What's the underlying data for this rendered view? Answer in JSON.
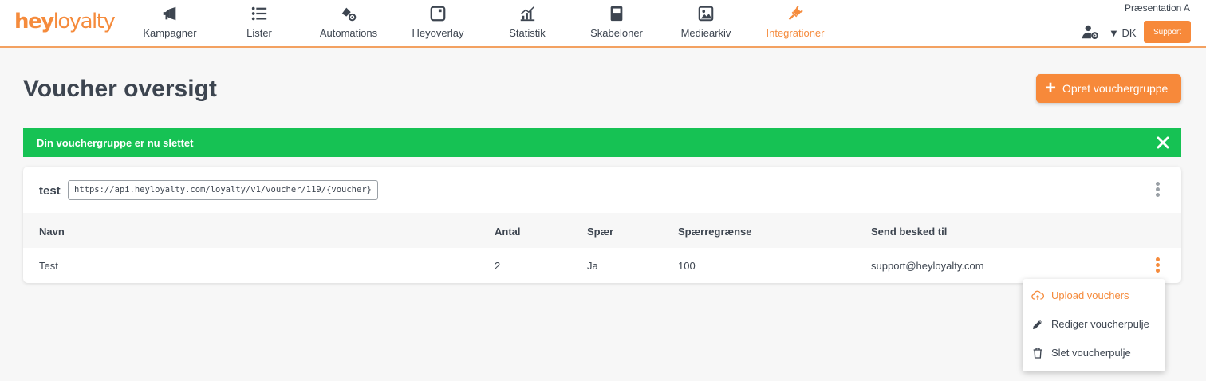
{
  "brand": {
    "logo_bold": "hey",
    "logo_light": "loyalty",
    "accent": "#f58b3c",
    "success": "#16c254"
  },
  "nav": [
    {
      "label": "Kampagner",
      "icon": "megaphone-icon"
    },
    {
      "label": "Lister",
      "icon": "list-icon"
    },
    {
      "label": "Automations",
      "icon": "automation-icon"
    },
    {
      "label": "Heyoverlay",
      "icon": "overlay-icon"
    },
    {
      "label": "Statistik",
      "icon": "chart-icon"
    },
    {
      "label": "Skabeloner",
      "icon": "template-icon"
    },
    {
      "label": "Mediearkiv",
      "icon": "image-icon"
    },
    {
      "label": "Integrationer",
      "icon": "plug-icon",
      "active": true
    }
  ],
  "account": {
    "name": "Præsentation A",
    "language": "DK",
    "support_label": "Support"
  },
  "page": {
    "title": "Voucher oversigt",
    "create_button": "Opret vouchergruppe"
  },
  "alert": {
    "message": "Din vouchergruppe er nu slettet"
  },
  "group": {
    "name": "test",
    "api_url": "https://api.heyloyalty.com/loyalty/v1/voucher/119/{voucher}",
    "columns": [
      "Navn",
      "Antal",
      "Spær",
      "Spærregrænse",
      "Send besked til"
    ],
    "rows": [
      {
        "navn": "Test",
        "antal": "2",
        "spaer": "Ja",
        "spaerregraense": "100",
        "send_besked_til": "support@heyloyalty.com"
      }
    ]
  },
  "row_menu": [
    {
      "label": "Upload vouchers",
      "icon": "upload-cloud-icon",
      "active": true
    },
    {
      "label": "Rediger voucherpulje",
      "icon": "pencil-icon"
    },
    {
      "label": "Slet voucherpulje",
      "icon": "trash-icon"
    }
  ]
}
